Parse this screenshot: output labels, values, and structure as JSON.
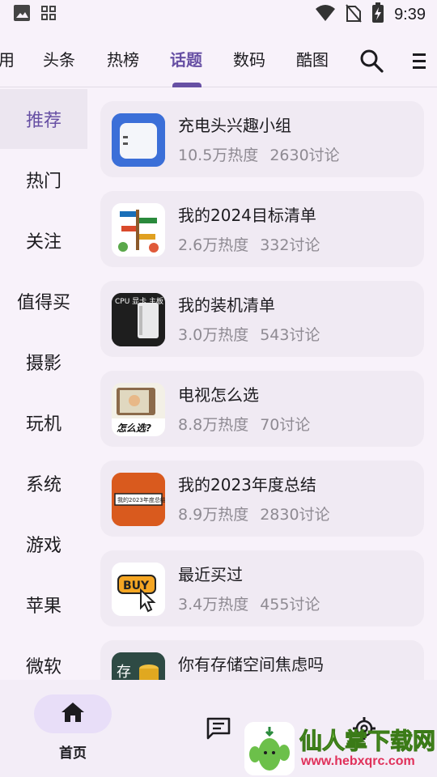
{
  "status_bar": {
    "time": "9:39",
    "icons": [
      "image-icon",
      "apps-grid-icon",
      "wifi-icon",
      "no-sim-icon",
      "battery-charging-icon"
    ]
  },
  "top_tabs": {
    "items": [
      {
        "label": "用"
      },
      {
        "label": "头条"
      },
      {
        "label": "热榜"
      },
      {
        "label": "话题",
        "active": true
      },
      {
        "label": "数码"
      },
      {
        "label": "酷图"
      }
    ],
    "accent_color": "#6750a4"
  },
  "sidebar": {
    "items": [
      {
        "label": "推荐",
        "active": true
      },
      {
        "label": "热门"
      },
      {
        "label": "关注"
      },
      {
        "label": "值得买"
      },
      {
        "label": "摄影"
      },
      {
        "label": "玩机"
      },
      {
        "label": "系统"
      },
      {
        "label": "游戏"
      },
      {
        "label": "苹果"
      },
      {
        "label": "微软"
      }
    ]
  },
  "topics": [
    {
      "title": "充电头兴趣小组",
      "heat": "10.5万热度",
      "discuss": "2630讨论",
      "thumb_text": ""
    },
    {
      "title": "我的2024目标清单",
      "heat": "2.6万热度",
      "discuss": "332讨论",
      "thumb_text": ""
    },
    {
      "title": "我的装机清单",
      "heat": "3.0万热度",
      "discuss": "543讨论",
      "thumb_text": "CPU 显卡 主板 内存 硬盘"
    },
    {
      "title": "电视怎么选",
      "heat": "8.8万热度",
      "discuss": "70讨论",
      "thumb_text": "怎么选?"
    },
    {
      "title": "我的2023年度总结",
      "heat": "8.9万热度",
      "discuss": "2830讨论",
      "thumb_text": "我的2023年度总结"
    },
    {
      "title": "最近买过",
      "heat": "3.4万热度",
      "discuss": "455讨论",
      "thumb_text": "BUY"
    },
    {
      "title": "你有存储空间焦虑吗",
      "heat": "",
      "discuss": "",
      "thumb_text": "存"
    }
  ],
  "bottom_nav": {
    "home_label": "首页"
  },
  "watermark": {
    "title": "仙人掌下载网",
    "url": "www.hebxqrc.com"
  }
}
